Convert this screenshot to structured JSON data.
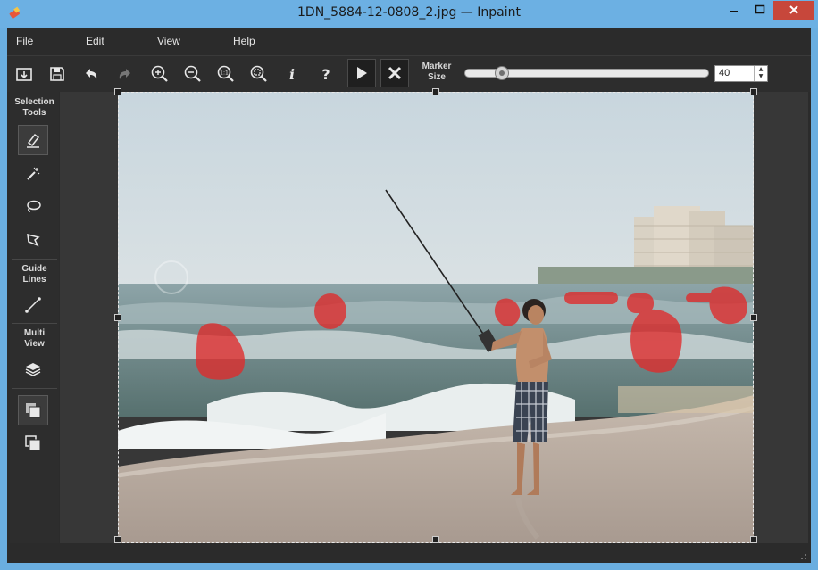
{
  "window": {
    "title": "1DN_5884-12-0808_2.jpg — Inpaint",
    "controls": [
      "minimize-icon",
      "maximize-icon",
      "close-icon"
    ]
  },
  "menu": {
    "items": [
      "File",
      "Edit",
      "View",
      "Help"
    ]
  },
  "toolbar": {
    "buttons": [
      "open-icon",
      "save-icon",
      "undo-icon",
      "redo-icon",
      "zoom-in-icon",
      "zoom-out-icon",
      "zoom-actual-icon",
      "zoom-fit-icon",
      "info-icon",
      "help-icon",
      "run-icon",
      "cancel-icon"
    ],
    "zoom_actual_text": "1:1",
    "marker_label_line1": "Marker",
    "marker_label_line2": "Size",
    "marker_size": "40",
    "marker_slider_fraction": 0.13
  },
  "sidebar": {
    "selection_label_line1": "Selection",
    "selection_label_line2": "Tools",
    "guide_label_line1": "Guide",
    "guide_label_line2": "Lines",
    "multi_label_line1": "Multi",
    "multi_label_line2": "View",
    "tools": [
      "marker-icon",
      "magic-wand-icon",
      "lasso-icon",
      "polygonal-lasso-icon",
      "guide-line-icon",
      "layers-icon",
      "copy-view-icon",
      "paste-view-icon"
    ]
  },
  "canvas": {
    "image_content": "beach-scene-boy-fishing-with-red-marked-people",
    "marker_color": "#e03030"
  },
  "colors": {
    "titlebar": "#6cb0e3",
    "close_button": "#c7473b",
    "panel": "#2b2b2b"
  }
}
